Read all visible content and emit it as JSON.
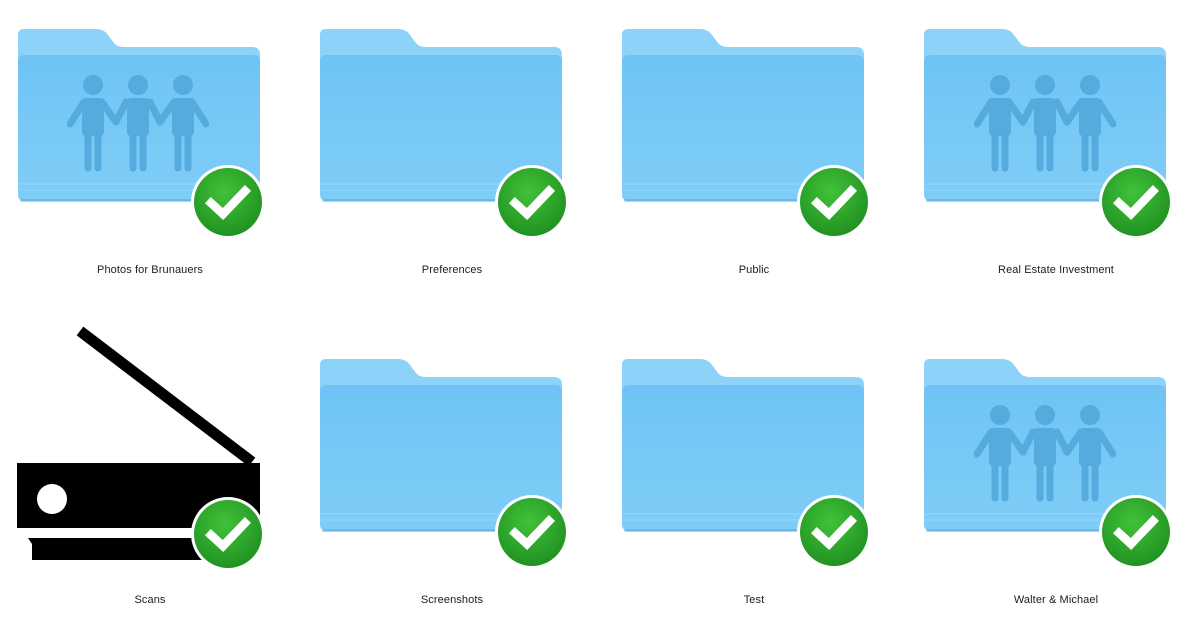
{
  "view": "finder-icon-view",
  "colors": {
    "folder_back": "#8fd3f9",
    "folder_front": "#6cc1f3",
    "folder_glyph": "#54a9de",
    "badge_green": "#2ea52c",
    "badge_check": "#ffffff",
    "scanner_black": "#000000"
  },
  "items": [
    {
      "name": "Photos for Brunauers",
      "icon": "shared-folder-icon",
      "status": "synced-checkmark-badge"
    },
    {
      "name": "Preferences",
      "icon": "folder-icon",
      "status": "synced-checkmark-badge"
    },
    {
      "name": "Public",
      "icon": "folder-icon",
      "status": "synced-checkmark-badge"
    },
    {
      "name": "Real Estate Investment",
      "icon": "shared-folder-icon",
      "status": "synced-checkmark-badge"
    },
    {
      "name": "Scans",
      "icon": "scanner-icon",
      "status": "synced-checkmark-badge"
    },
    {
      "name": "Screenshots",
      "icon": "folder-icon",
      "status": "synced-checkmark-badge"
    },
    {
      "name": "Test",
      "icon": "folder-icon",
      "status": "synced-checkmark-badge"
    },
    {
      "name": "Walter & Michael",
      "icon": "shared-folder-icon",
      "status": "synced-checkmark-badge"
    }
  ]
}
